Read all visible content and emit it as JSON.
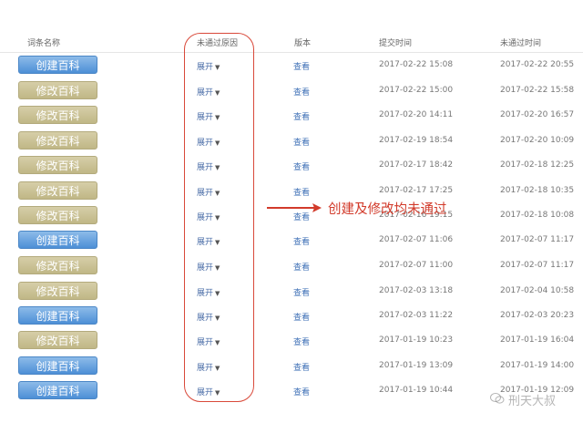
{
  "table": {
    "headers": {
      "name": "词条名称",
      "reason": "未通过原因",
      "version": "版本",
      "submit_time": "提交时间",
      "fail_time": "未通过时间"
    },
    "expand_label": "展开",
    "view_label": "查看",
    "rows": [
      {
        "action": "创建百科",
        "type": "create",
        "submit": "2017-02-22 15:08",
        "fail": "2017-02-22 20:55"
      },
      {
        "action": "修改百科",
        "type": "modify",
        "submit": "2017-02-22 15:00",
        "fail": "2017-02-22 15:58"
      },
      {
        "action": "修改百科",
        "type": "modify",
        "submit": "2017-02-20 14:11",
        "fail": "2017-02-20 16:57"
      },
      {
        "action": "修改百科",
        "type": "modify",
        "submit": "2017-02-19 18:54",
        "fail": "2017-02-20 10:09"
      },
      {
        "action": "修改百科",
        "type": "modify",
        "submit": "2017-02-17 18:42",
        "fail": "2017-02-18 12:25"
      },
      {
        "action": "修改百科",
        "type": "modify",
        "submit": "2017-02-17 17:25",
        "fail": "2017-02-18 10:35"
      },
      {
        "action": "修改百科",
        "type": "modify",
        "submit": "2017-02-16 19:15",
        "fail": "2017-02-18 10:08"
      },
      {
        "action": "创建百科",
        "type": "create",
        "submit": "2017-02-07 11:06",
        "fail": "2017-02-07 11:17"
      },
      {
        "action": "修改百科",
        "type": "modify",
        "submit": "2017-02-07 11:00",
        "fail": "2017-02-07 11:17"
      },
      {
        "action": "修改百科",
        "type": "modify",
        "submit": "2017-02-03 13:18",
        "fail": "2017-02-04 10:58"
      },
      {
        "action": "创建百科",
        "type": "create",
        "submit": "2017-02-03 11:22",
        "fail": "2017-02-03 20:23"
      },
      {
        "action": "修改百科",
        "type": "modify",
        "submit": "2017-01-19 10:23",
        "fail": "2017-01-19 16:04"
      },
      {
        "action": "创建百科",
        "type": "create",
        "submit": "2017-01-19 13:09",
        "fail": "2017-01-19 14:00"
      },
      {
        "action": "创建百科",
        "type": "create",
        "submit": "2017-01-19 10:44",
        "fail": "2017-01-19 12:09"
      }
    ]
  },
  "annotation": {
    "text": "创建及修改均未通过",
    "color": "#d23b2b"
  },
  "watermark": {
    "text": "刑天大叔",
    "icon": "wechat-icon"
  },
  "colors": {
    "create_button": "#4d8fd6",
    "modify_button": "#c0b786",
    "link": "#3d6fb6",
    "highlight": "#d9493a"
  }
}
